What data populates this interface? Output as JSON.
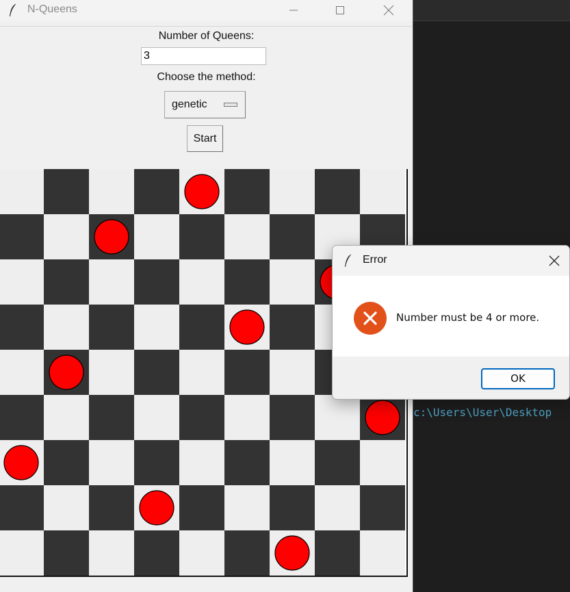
{
  "window": {
    "title": "N-Queens",
    "label_queens": "Number of Queens:",
    "queens_value": "3",
    "label_method": "Choose the method:",
    "method_selected": "genetic",
    "start_label": "Start"
  },
  "board": {
    "size": 9,
    "light_color": "#eeeeee",
    "dark_color": "#333333",
    "queen_color": "#ff0000",
    "queens": [
      {
        "row": 0,
        "col": 4
      },
      {
        "row": 1,
        "col": 2
      },
      {
        "row": 2,
        "col": 7
      },
      {
        "row": 3,
        "col": 5
      },
      {
        "row": 4,
        "col": 1
      },
      {
        "row": 5,
        "col": 8
      },
      {
        "row": 6,
        "col": 0
      },
      {
        "row": 7,
        "col": 3
      },
      {
        "row": 8,
        "col": 6
      }
    ]
  },
  "dialog": {
    "title": "Error",
    "message": "Number must be 4 or more.",
    "ok_label": "OK",
    "icon": "error-icon",
    "icon_color": "#e2511a"
  },
  "terminal": {
    "path_text": "c:\\Users\\User\\Desktop"
  }
}
